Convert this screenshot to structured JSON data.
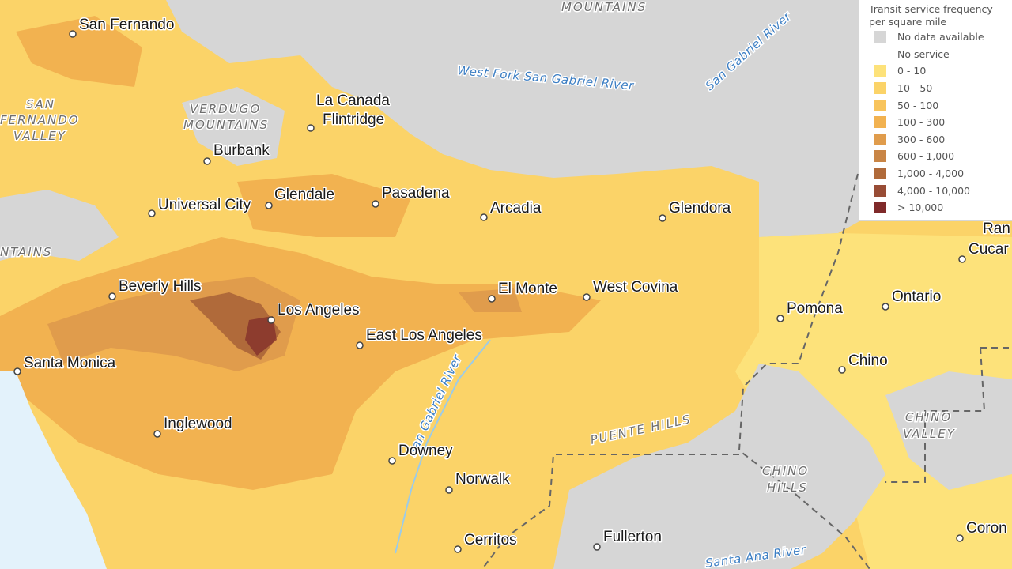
{
  "map": {
    "cities": [
      {
        "name": "San Fernando"
      },
      {
        "name": "La Canada"
      },
      {
        "name": "Flintridge"
      },
      {
        "name": "Burbank"
      },
      {
        "name": "Universal City"
      },
      {
        "name": "Glendale"
      },
      {
        "name": "Pasadena"
      },
      {
        "name": "Arcadia"
      },
      {
        "name": "Glendora"
      },
      {
        "name": "Beverly Hills"
      },
      {
        "name": "Los Angeles"
      },
      {
        "name": "East Los Angeles"
      },
      {
        "name": "El Monte"
      },
      {
        "name": "West Covina"
      },
      {
        "name": "Pomona"
      },
      {
        "name": "Ontario"
      },
      {
        "name": "Cucar"
      },
      {
        "name": "Ran"
      },
      {
        "name": "Chino"
      },
      {
        "name": "Santa Monica"
      },
      {
        "name": "Inglewood"
      },
      {
        "name": "Downey"
      },
      {
        "name": "Norwalk"
      },
      {
        "name": "Cerritos"
      },
      {
        "name": "Fullerton"
      },
      {
        "name": "Coron"
      }
    ],
    "regions": [
      {
        "name": "MOUNTAINS"
      },
      {
        "name": "SAN"
      },
      {
        "name": "FERNANDO"
      },
      {
        "name": "VALLEY"
      },
      {
        "name": "VERDUGO"
      },
      {
        "name": "MOUNTAINS"
      },
      {
        "name": "NTAINS"
      },
      {
        "name": "PUENTE HILLS"
      },
      {
        "name": "CHINO"
      },
      {
        "name": "HILLS"
      },
      {
        "name": "CHINO"
      },
      {
        "name": "VALLEY"
      }
    ],
    "rivers": [
      {
        "name": "West Fork San Gabriel River"
      },
      {
        "name": "San Gabriel River"
      },
      {
        "name": "San Gabriel River"
      },
      {
        "name": "Santa Ana River"
      }
    ],
    "colors": {
      "no_data": "#d6d6d6",
      "ocean": "#e3f2fb",
      "river": "#3d7fc4"
    }
  },
  "legend": {
    "title": "Transit service frequency per square mile",
    "items": [
      {
        "label": "No data available",
        "color": "#d6d6d6"
      },
      {
        "label": "No service",
        "color": "#ffffff"
      },
      {
        "label": "0 - 10",
        "color": "#fde27a"
      },
      {
        "label": "10 - 50",
        "color": "#fbd368"
      },
      {
        "label": "50 - 100",
        "color": "#f8c45c"
      },
      {
        "label": "100 - 300",
        "color": "#f2b250"
      },
      {
        "label": "300 - 600",
        "color": "#e09c4c"
      },
      {
        "label": "600 - 1,000",
        "color": "#c98545"
      },
      {
        "label": "1,000 - 4,000",
        "color": "#b06a3a"
      },
      {
        "label": "4,000 - 10,000",
        "color": "#984c35"
      },
      {
        "label": "> 10,000",
        "color": "#7f2a2a"
      }
    ]
  }
}
